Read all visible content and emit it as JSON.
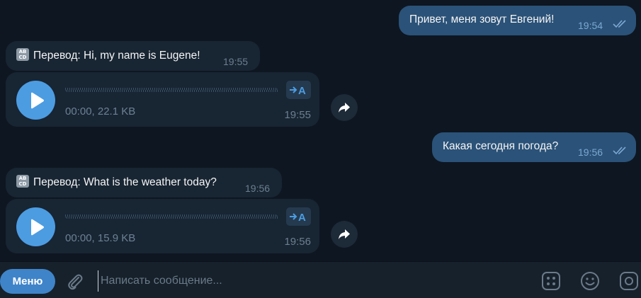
{
  "messages": [
    {
      "kind": "out",
      "text": "Привет, меня зовут Евгений!",
      "time": "19:54",
      "status": "read"
    },
    {
      "kind": "in-translation",
      "label": "Перевод: Hi, my name is Eugene!",
      "time": "19:55",
      "icon": "abc-icon"
    },
    {
      "kind": "in-voice",
      "duration_size": "00:00, 22.1 KB",
      "time": "19:55",
      "transcribe_label": "→A"
    },
    {
      "kind": "out",
      "text": "Какая сегодня погода?",
      "time": "19:56",
      "status": "read"
    },
    {
      "kind": "in-translation",
      "label": "Перевод: What is the weather today?",
      "time": "19:56",
      "icon": "abc-icon"
    },
    {
      "kind": "in-voice",
      "duration_size": "00:00, 15.9 KB",
      "time": "19:56",
      "transcribe_label": "→A"
    }
  ],
  "abc_icon": {
    "top": "AB",
    "bottom": "CD"
  },
  "composer": {
    "menu_label": "Меню",
    "placeholder": "Написать сообщение...",
    "icons": [
      "attach-icon",
      "bot-commands-icon",
      "emoji-icon",
      "camera-icon"
    ]
  },
  "colors": {
    "background": "#0e1621",
    "outgoing_bubble": "#2b5278",
    "incoming_bubble": "#182533",
    "accent": "#4c9ce2",
    "composer": "#17212b"
  }
}
